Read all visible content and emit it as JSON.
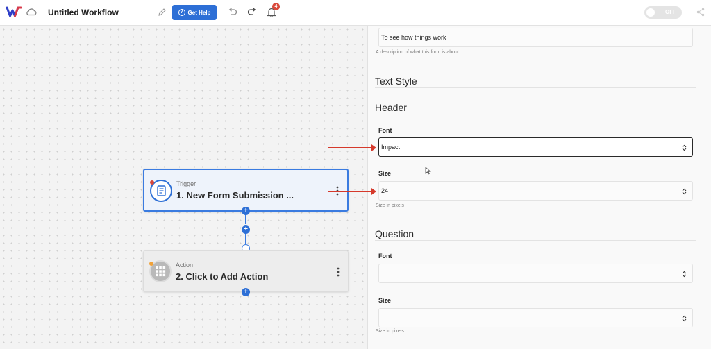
{
  "topbar": {
    "title": "Untitled Workflow",
    "help_label": "Get Help",
    "notification_count": "4",
    "toggle_label": "OFF",
    "logo_icon": "logo-icon",
    "cloud_icon": "cloud-icon"
  },
  "canvas": {
    "trigger": {
      "kind": "Trigger",
      "title": "1. New Form Submission ..."
    },
    "action": {
      "kind": "Action",
      "title": "2. Click to Add Action"
    }
  },
  "panel": {
    "description": {
      "value": "To see how things work",
      "hint": "A description of what this form is about"
    },
    "text_style_heading": "Text Style",
    "header": {
      "heading": "Header",
      "font_label": "Font",
      "font_value": "Impact",
      "size_label": "Size",
      "size_value": "24",
      "size_hint": "Size in pixels"
    },
    "question": {
      "heading": "Question",
      "font_label": "Font",
      "font_value": "",
      "size_label": "Size",
      "size_value": "",
      "size_hint": "Size in pixels"
    }
  },
  "colors": {
    "accent": "#2d6fd6",
    "annotation_arrow": "#d5392b",
    "trigger_dot": "#d9473b",
    "action_dot": "#f0a23a"
  }
}
